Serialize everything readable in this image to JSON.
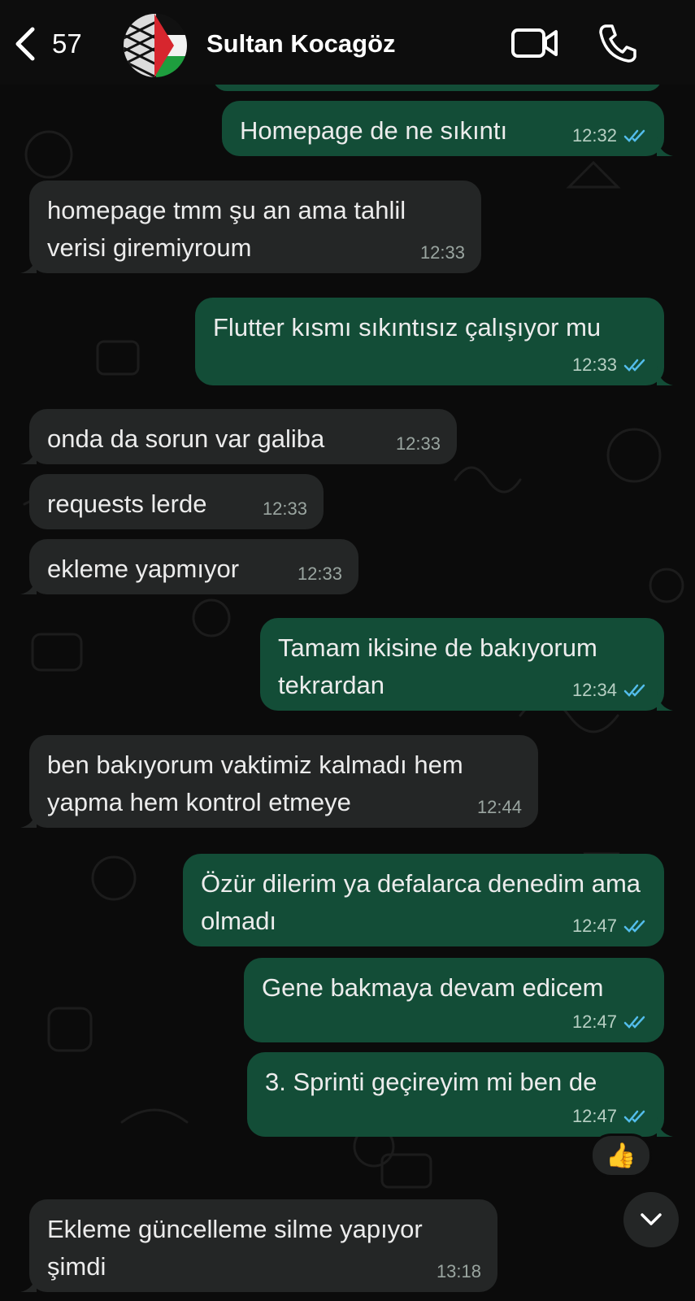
{
  "header": {
    "back_count": "57",
    "contact_name": "Sultan Kocagöz",
    "avatar_icon": "avatar-flag-keffiyeh",
    "video_icon": "video-call-icon",
    "phone_icon": "phone-call-icon"
  },
  "colors": {
    "incoming_bubble": "#242626",
    "outgoing_bubble": "#134d37",
    "read_ticks": "#53bdeb",
    "background": "#0b0b0b"
  },
  "messages": [
    {
      "direction": "out",
      "text": "Homepage de ne sıkıntı",
      "time": "12:32",
      "status": "read"
    },
    {
      "direction": "in",
      "text": "homepage tmm şu an ama tahlil verisi giremiyroum",
      "time": "12:33"
    },
    {
      "direction": "out",
      "text": "Flutter kısmı sıkıntısız çalışıyor mu",
      "time": "12:33",
      "status": "read"
    },
    {
      "direction": "in",
      "text": "onda da sorun var galiba",
      "time": "12:33"
    },
    {
      "direction": "in",
      "text": "requests lerde",
      "time": "12:33"
    },
    {
      "direction": "in",
      "text": "ekleme yapmıyor",
      "time": "12:33"
    },
    {
      "direction": "out",
      "text": "Tamam ikisine de bakıyorum tekrardan",
      "time": "12:34",
      "status": "read"
    },
    {
      "direction": "in",
      "text": "ben bakıyorum vaktimiz kalmadı hem yapma hem kontrol etmeye",
      "time": "12:44"
    },
    {
      "direction": "out",
      "text": "Özür dilerim ya defalarca denedim ama olmadı",
      "time": "12:47",
      "status": "read"
    },
    {
      "direction": "out",
      "text": "Gene bakmaya devam edicem",
      "time": "12:47",
      "status": "read"
    },
    {
      "direction": "out",
      "text": "3. Sprinti geçireyim mi ben de",
      "time": "12:47",
      "status": "read",
      "reaction": "👍"
    },
    {
      "direction": "in",
      "text": "Ekleme güncelleme silme yapıyor şimdi",
      "time": "13:18"
    }
  ],
  "scroll_down_icon": "chevron-down-icon"
}
